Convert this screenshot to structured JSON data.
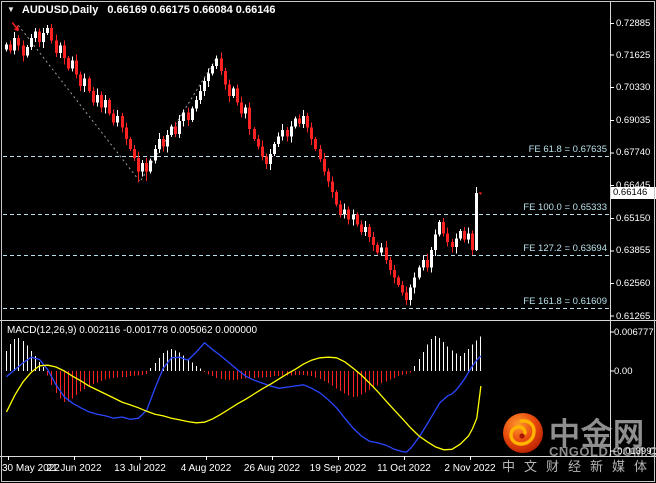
{
  "header": {
    "symbol": "AUDUSD,Daily",
    "ohlc": "0.66169 0.66175 0.66084 0.66146",
    "dropdown_icon": "▼"
  },
  "watermark": {
    "cn": "中金网",
    "domain": "CNGOLD.COM.CN",
    "tagline": "中文财经新媒体"
  },
  "colors": {
    "background": "#000000",
    "bull": "#ffffff",
    "bear": "#ff2222",
    "fib": "#b9e0ea",
    "zigzag": "#9a9a9a",
    "macd_line": "#2a46ff",
    "signal_line": "#ffff00",
    "axis_line": "#d8d8d8",
    "axis_text": "#ffffff",
    "logo_orange": "#e8490d",
    "logo_gold": "#ffb400"
  },
  "chart_data": {
    "type": "candlestick",
    "symbol": "AUDUSD",
    "timeframe": "Daily",
    "price_pane": {
      "axis_labels": [
        "0.72885",
        "0.71625",
        "0.70330",
        "0.69035",
        "0.67740",
        "0.66445",
        "0.65150",
        "0.63855",
        "0.62560",
        "0.61265"
      ],
      "current_price": "0.66146",
      "current_price_value": 0.66146,
      "fib_levels": [
        {
          "label": "FE 61.8 = 0.67635",
          "value": 0.67635
        },
        {
          "label": "FE 100.0 = 0.65333",
          "value": 0.65333
        },
        {
          "label": "FE 127.2 = 0.63694",
          "value": 0.63694
        },
        {
          "label": "FE 161.8 = 0.61609",
          "value": 0.61609
        }
      ],
      "zigzag": [
        {
          "bar": 3,
          "price": 0.728
        },
        {
          "bar": 32.5,
          "price": 0.666
        },
        {
          "bar": 51,
          "price": 0.715
        }
      ],
      "sell_arrow": {
        "bar": 2.5,
        "price": 0.7268
      },
      "closes": [
        0.7205,
        0.718,
        0.723,
        0.72,
        0.716,
        0.7195,
        0.723,
        0.7255,
        0.7215,
        0.725,
        0.727,
        0.722,
        0.717,
        0.72,
        0.715,
        0.711,
        0.714,
        0.7085,
        0.704,
        0.707,
        0.702,
        0.6975,
        0.7005,
        0.6955,
        0.6985,
        0.693,
        0.6895,
        0.692,
        0.6875,
        0.683,
        0.679,
        0.6755,
        0.67,
        0.6735,
        0.67,
        0.6745,
        0.679,
        0.683,
        0.68,
        0.6845,
        0.688,
        0.685,
        0.69,
        0.6935,
        0.6905,
        0.695,
        0.6985,
        0.702,
        0.706,
        0.709,
        0.712,
        0.7148,
        0.71,
        0.7045,
        0.7,
        0.703,
        0.6975,
        0.693,
        0.6955,
        0.687,
        0.683,
        0.68,
        0.676,
        0.673,
        0.677,
        0.681,
        0.684,
        0.6865,
        0.684,
        0.688,
        0.691,
        0.689,
        0.692,
        0.6875,
        0.683,
        0.679,
        0.675,
        0.67,
        0.666,
        0.662,
        0.657,
        0.653,
        0.655,
        0.651,
        0.653,
        0.649,
        0.646,
        0.648,
        0.644,
        0.641,
        0.638,
        0.64,
        0.635,
        0.631,
        0.628,
        0.625,
        0.622,
        0.619,
        0.624,
        0.628,
        0.632,
        0.635,
        0.632,
        0.639,
        0.645,
        0.65,
        0.6455,
        0.642,
        0.64,
        0.6435,
        0.6465,
        0.643,
        0.6455,
        0.639,
        0.6615,
        0.66146
      ],
      "overrides": {
        "0": {
          "o": 0.7185
        },
        "7": {
          "h": 0.727
        },
        "10": {
          "h": 0.7282
        },
        "32": {
          "l": 0.6656
        },
        "34": {
          "l": 0.6662
        },
        "51": {
          "h": 0.716
        },
        "97": {
          "l": 0.6171
        },
        "114": {
          "h": 0.664,
          "l": 0.6385
        },
        "115": {
          "o": 0.66169,
          "h": 0.66175,
          "l": 0.66084
        }
      }
    },
    "macd_pane": {
      "label": "MACD(12,26,9) 0.002116 -0.001778 0.005062 0.000000",
      "axis_labels": [
        "0.006777",
        "0.00",
        "-0.013991"
      ],
      "histogram": [
        0.0035,
        0.0047,
        0.0056,
        0.0057,
        0.0052,
        0.0044,
        0.0035,
        0.0026,
        0.0016,
        0.0007,
        -0.0008,
        -0.0024,
        -0.0038,
        -0.0048,
        -0.0054,
        -0.0053,
        -0.0048,
        -0.0042,
        -0.0036,
        -0.0031,
        -0.0027,
        -0.0023,
        -0.002,
        -0.0017,
        -0.0015,
        -0.0013,
        -0.0012,
        -0.0011,
        -0.001,
        -0.001,
        -0.0009,
        -0.0008,
        -0.0008,
        -0.0007,
        -0.0005,
        0.0005,
        0.0014,
        0.0023,
        0.0031,
        0.0036,
        0.0038,
        0.0036,
        0.0032,
        0.0027,
        0.0021,
        0.0015,
        0.0009,
        0.0004,
        -0.0002,
        -0.0006,
        -0.0009,
        -0.0012,
        -0.0014,
        -0.0015,
        -0.0016,
        -0.0016,
        -0.0015,
        -0.0014,
        -0.0013,
        -0.0012,
        -0.0012,
        -0.0011,
        -0.0011,
        -0.001,
        -0.001,
        -0.0009,
        -0.0009,
        -0.0008,
        -0.0008,
        -0.0008,
        -0.0007,
        -0.0007,
        -0.0007,
        -0.0008,
        -0.0009,
        -0.0011,
        -0.0014,
        -0.0017,
        -0.0021,
        -0.0025,
        -0.003,
        -0.0035,
        -0.0039,
        -0.0043,
        -0.0045,
        -0.0044,
        -0.0041,
        -0.0037,
        -0.0033,
        -0.0029,
        -0.0025,
        -0.0021,
        -0.0018,
        -0.0015,
        -0.0012,
        -0.0009,
        -0.0007,
        -0.0005,
        -0.0003,
        0.0009,
        0.0021,
        0.0033,
        0.0046,
        0.0056,
        0.0061,
        0.0057,
        0.005,
        0.0043,
        0.0036,
        0.003,
        0.0026,
        0.0031,
        0.0038,
        0.0046,
        0.0053,
        0.006
      ],
      "macd_line": [
        [
          0,
          -0.001
        ],
        [
          2,
          0.0002
        ],
        [
          4,
          0.0014
        ],
        [
          6,
          0.0024
        ],
        [
          8,
          0.002
        ],
        [
          10,
          0.0002
        ],
        [
          12,
          -0.0024
        ],
        [
          14,
          -0.0045
        ],
        [
          16,
          -0.0056
        ],
        [
          18,
          -0.0064
        ],
        [
          20,
          -0.0071
        ],
        [
          22,
          -0.0075
        ],
        [
          24,
          -0.0078
        ],
        [
          26,
          -0.0082
        ],
        [
          28,
          -0.008
        ],
        [
          30,
          -0.0084
        ],
        [
          32,
          -0.0082
        ],
        [
          34,
          -0.0068
        ],
        [
          36,
          -0.003
        ],
        [
          38,
          0.0005
        ],
        [
          40,
          0.0023
        ],
        [
          42,
          0.0024
        ],
        [
          44,
          0.0019
        ],
        [
          46,
          0.0033
        ],
        [
          48,
          0.0049
        ],
        [
          50,
          0.0037
        ],
        [
          52,
          0.0026
        ],
        [
          54,
          0.0014
        ],
        [
          56,
          0.0002
        ],
        [
          58,
          -0.0009
        ],
        [
          60,
          -0.0016
        ],
        [
          62,
          -0.0021
        ],
        [
          64,
          -0.0026
        ],
        [
          66,
          -0.003
        ],
        [
          68,
          -0.0028
        ],
        [
          70,
          -0.0026
        ],
        [
          72,
          -0.0024
        ],
        [
          74,
          -0.003
        ],
        [
          76,
          -0.0038
        ],
        [
          78,
          -0.005
        ],
        [
          80,
          -0.0064
        ],
        [
          82,
          -0.0082
        ],
        [
          84,
          -0.0099
        ],
        [
          86,
          -0.0113
        ],
        [
          88,
          -0.0122
        ],
        [
          90,
          -0.0125
        ],
        [
          92,
          -0.0129
        ],
        [
          94,
          -0.0136
        ],
        [
          96,
          -0.014
        ],
        [
          97,
          -0.0141
        ],
        [
          98,
          -0.0134
        ],
        [
          100,
          -0.0115
        ],
        [
          102,
          -0.0092
        ],
        [
          104,
          -0.0068
        ],
        [
          105,
          -0.0056
        ],
        [
          106,
          -0.0049
        ],
        [
          107,
          -0.0043
        ],
        [
          108,
          -0.004
        ],
        [
          109,
          -0.0033
        ],
        [
          110,
          -0.0024
        ],
        [
          111,
          -0.0014
        ],
        [
          112,
          -0.0002
        ],
        [
          113,
          0.0009
        ],
        [
          114,
          0.0019
        ],
        [
          115,
          0.0026
        ]
      ],
      "signal_line": [
        [
          0,
          -0.0071
        ],
        [
          2,
          -0.0042
        ],
        [
          4,
          -0.0019
        ],
        [
          6,
          -0.0002
        ],
        [
          8,
          0.0009
        ],
        [
          10,
          0.001
        ],
        [
          12,
          0.0007
        ],
        [
          14,
          0.0
        ],
        [
          16,
          -0.0009
        ],
        [
          18,
          -0.0017
        ],
        [
          20,
          -0.0026
        ],
        [
          22,
          -0.0033
        ],
        [
          24,
          -0.004
        ],
        [
          26,
          -0.0047
        ],
        [
          28,
          -0.0054
        ],
        [
          30,
          -0.0059
        ],
        [
          32,
          -0.0064
        ],
        [
          34,
          -0.007
        ],
        [
          36,
          -0.0075
        ],
        [
          38,
          -0.0078
        ],
        [
          40,
          -0.0082
        ],
        [
          42,
          -0.0085
        ],
        [
          44,
          -0.0088
        ],
        [
          46,
          -0.009
        ],
        [
          48,
          -0.0089
        ],
        [
          50,
          -0.0083
        ],
        [
          52,
          -0.0075
        ],
        [
          54,
          -0.0066
        ],
        [
          56,
          -0.0057
        ],
        [
          58,
          -0.0049
        ],
        [
          60,
          -0.004
        ],
        [
          62,
          -0.0031
        ],
        [
          64,
          -0.0023
        ],
        [
          66,
          -0.0014
        ],
        [
          68,
          -0.0005
        ],
        [
          70,
          0.0003
        ],
        [
          72,
          0.0012
        ],
        [
          74,
          0.0019
        ],
        [
          76,
          0.0023
        ],
        [
          78,
          0.0024
        ],
        [
          80,
          0.0023
        ],
        [
          82,
          0.0016
        ],
        [
          84,
          0.0005
        ],
        [
          86,
          -0.0007
        ],
        [
          88,
          -0.0021
        ],
        [
          90,
          -0.0036
        ],
        [
          92,
          -0.0052
        ],
        [
          94,
          -0.0068
        ],
        [
          96,
          -0.0083
        ],
        [
          98,
          -0.0099
        ],
        [
          100,
          -0.0113
        ],
        [
          102,
          -0.0123
        ],
        [
          104,
          -0.0132
        ],
        [
          106,
          -0.0137
        ],
        [
          108,
          -0.0136
        ],
        [
          110,
          -0.0127
        ],
        [
          112,
          -0.0113
        ],
        [
          113,
          -0.01
        ],
        [
          114,
          -0.0082
        ],
        [
          115,
          -0.0026
        ]
      ]
    },
    "time_axis": {
      "labels": [
        "30 May 2022",
        "21 Jun 2022",
        "13 Jul 2022",
        "4 Aug 2022",
        "26 Aug 2022",
        "19 Sep 2022",
        "11 Oct 2022",
        "2 Nov 2022"
      ]
    }
  }
}
